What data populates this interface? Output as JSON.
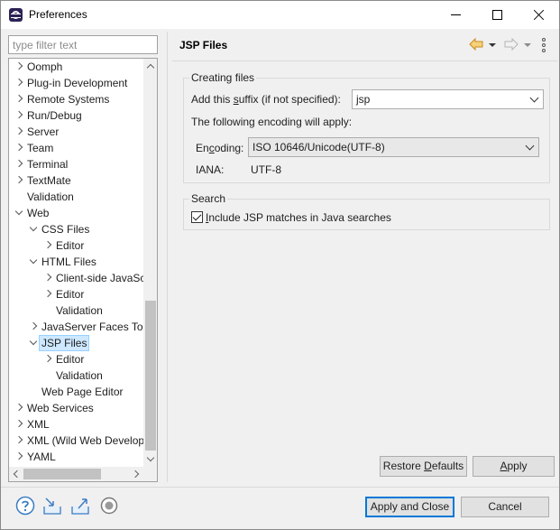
{
  "window": {
    "title": "Preferences"
  },
  "filter": {
    "placeholder": "type filter text"
  },
  "tree": {
    "items": [
      {
        "label": "Oomph",
        "state": "closed"
      },
      {
        "label": "Plug-in Development",
        "state": "closed"
      },
      {
        "label": "Remote Systems",
        "state": "closed"
      },
      {
        "label": "Run/Debug",
        "state": "closed"
      },
      {
        "label": "Server",
        "state": "closed"
      },
      {
        "label": "Team",
        "state": "closed"
      },
      {
        "label": "Terminal",
        "state": "closed"
      },
      {
        "label": "TextMate",
        "state": "closed"
      },
      {
        "label": "Validation",
        "state": "leaf"
      },
      {
        "label": "Web",
        "state": "open"
      },
      {
        "label": "CSS Files",
        "state": "open"
      },
      {
        "label": "Editor",
        "state": "closed"
      },
      {
        "label": "HTML Files",
        "state": "open"
      },
      {
        "label": "Client-side JavaSc",
        "state": "closed"
      },
      {
        "label": "Editor",
        "state": "closed"
      },
      {
        "label": "Validation",
        "state": "leaf"
      },
      {
        "label": "JavaServer Faces Too",
        "state": "closed"
      },
      {
        "label": "JSP Files",
        "state": "open",
        "selected": true
      },
      {
        "label": "Editor",
        "state": "closed"
      },
      {
        "label": "Validation",
        "state": "leaf"
      },
      {
        "label": "Web Page Editor",
        "state": "leaf"
      },
      {
        "label": "Web Services",
        "state": "closed"
      },
      {
        "label": "XML",
        "state": "closed"
      },
      {
        "label": "XML (Wild Web Develop",
        "state": "closed"
      },
      {
        "label": "YAML",
        "state": "closed"
      }
    ]
  },
  "page": {
    "title": "JSP Files",
    "creating_group": {
      "legend": "Creating files",
      "suffix_label_pre": "Add this ",
      "suffix_label_mnemonic": "s",
      "suffix_label_post": "uffix (if not specified):",
      "suffix_value": "jsp",
      "encoding_note": "The following encoding will apply:",
      "encoding_label_pre": "En",
      "encoding_label_mnemonic": "c",
      "encoding_label_post": "oding:",
      "encoding_value": "ISO 10646/Unicode(UTF-8)",
      "iana_label": "IANA:",
      "iana_value": "UTF-8"
    },
    "search_group": {
      "legend": "Search",
      "checkbox_label_pre": "",
      "checkbox_label_mnemonic": "I",
      "checkbox_label_post": "nclude JSP matches in Java searches",
      "checked": true
    },
    "restore_pre": "Restore ",
    "restore_mnemonic": "D",
    "restore_post": "efaults",
    "apply_mnemonic": "A",
    "apply_post": "pply"
  },
  "footer": {
    "apply_close": "Apply and Close",
    "cancel": "Cancel",
    "icons": [
      "help-icon",
      "import-icon",
      "export-icon",
      "record-icon"
    ]
  },
  "colors": {
    "accent": "#0078d7",
    "selection_bg": "#cde8ff",
    "nav_arrow": "#e8a33d",
    "icon_blue": "#3b7dc4"
  }
}
